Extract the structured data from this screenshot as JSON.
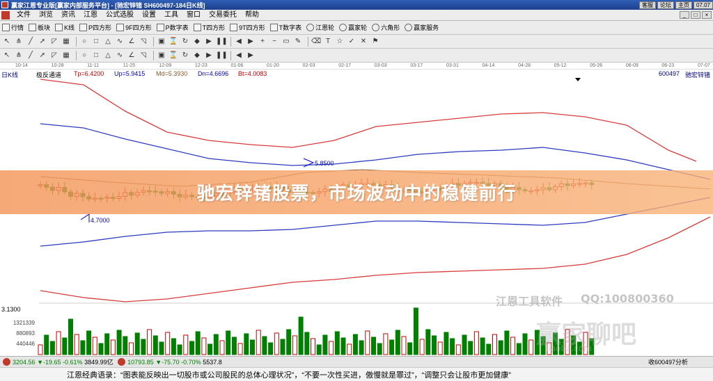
{
  "titlebar": {
    "title": "赢家江恩专业版[赢家内部服务平台] - [驰宏锌锗  SH600497-184日K线]",
    "buttons": [
      "客服",
      "论坛",
      "主页",
      "07.07"
    ]
  },
  "menubar": {
    "items": [
      "文件",
      "浏览",
      "资讯",
      "江恩",
      "公式选股",
      "设置",
      "工具",
      "窗口",
      "交易委托",
      "帮助"
    ],
    "controls": [
      "_",
      "□",
      "×"
    ]
  },
  "toolbar1": {
    "items": [
      {
        "icon": "list-icon",
        "label": "行情"
      },
      {
        "icon": "grid-icon",
        "label": "板块"
      },
      {
        "icon": "candle-icon",
        "label": "K线"
      },
      {
        "icon": "p-box-icon",
        "label": "P四方形"
      },
      {
        "icon": "9f-box-icon",
        "label": "9F四方形"
      },
      {
        "icon": "p-char-icon",
        "label": "P数字表"
      },
      {
        "icon": "t-box-icon",
        "label": "T四方形"
      },
      {
        "icon": "9t-box-icon",
        "label": "9T四方形"
      },
      {
        "icon": "t-char-icon",
        "label": "T数字表"
      },
      {
        "icon": "wheel-icon",
        "label": "江恩轮"
      },
      {
        "icon": "wheel2-icon",
        "label": "赢家轮"
      },
      {
        "icon": "hexagon-icon",
        "label": "六角形"
      },
      {
        "icon": "service-icon",
        "label": "赢家服务"
      }
    ]
  },
  "toolbar2": {
    "icons": [
      "cursor-icon",
      "fork-icon",
      "line-icon",
      "arrow-icon",
      "fan-icon",
      "grid-icon",
      "circle-icon",
      "square-icon",
      "triangle-icon",
      "wave-icon",
      "gann-angle-icon",
      "gann-fan-icon",
      "box-icon",
      "time-icon",
      "cycle-icon",
      "diamond-icon",
      "play-icon",
      "pause-icon",
      "left-arrow-icon",
      "right-arrow-icon",
      "zoom-in-icon",
      "zoom-out-icon",
      "ruler-icon",
      "pencil-icon",
      "eraser-icon",
      "text-icon",
      "star-icon",
      "check-icon",
      "cross-icon",
      "flag-icon"
    ]
  },
  "toolbar3": {
    "icons": [
      "arrow-up-icon",
      "fork-icon",
      "spiral-icon",
      "angle-icon",
      "wave-icon",
      "bar-icon",
      "pivot-icon",
      "square-icon",
      "lines-icon",
      "channel-icon",
      "cross-icon",
      "fan-icon",
      "grid-icon",
      "cycle-icon",
      "arc-icon",
      "box-icon",
      "time-icon",
      "star-icon",
      "pie-icon",
      "circle-icon"
    ]
  },
  "date_axis": {
    "labels": [
      "10-14",
      "10-28",
      "11-11",
      "11-25",
      "12-09",
      "12-23",
      "01-06",
      "01-20",
      "02-03",
      "02-17",
      "03-03",
      "03-17",
      "03-31",
      "04-14",
      "04-28",
      "05-12",
      "05-26",
      "06-09",
      "06-23",
      "07-07"
    ]
  },
  "indicator_header": {
    "chart_type": "日K线",
    "name": "极反通道",
    "tp": "Tp=6.4200",
    "up": "Up=5.9415",
    "md": "Md=5.3930",
    "dn": "Dn=4.6696",
    "bt": "Bt=4.0083",
    "code": "600497",
    "stock": "驰宏锌锗"
  },
  "chart_data": {
    "type": "candlestick",
    "annotations": {
      "high": "5.8500",
      "low": "4.7000"
    },
    "y_low_label": "3.1300",
    "volume_ticks": [
      "1321339",
      "880893",
      "440446"
    ]
  },
  "banner": {
    "title": "驰宏锌锗股票，市场波动中的稳健前行"
  },
  "watermarks": {
    "tools": "江恩工具软件",
    "qq": "QQ:100800360",
    "brand": "赢家聊吧",
    "site": "liaoba.com"
  },
  "statusbar": {
    "sh_index": "3204.56",
    "sh_change": "▼-19.65",
    "sh_pct": "-0.61%",
    "sh_amount": "3849.99亿",
    "sz_index": "10793.85",
    "sz_change": "▼-75.70",
    "sz_pct": "-0.70%",
    "sz_amount": "5537.8",
    "right_label": "收600497分析"
  },
  "quotebar": {
    "quote": "江恩经典语录：“图表能反映出一切股市或公司股民的总体心理状况”，“不要一次性买进，傲慢就是罪过”，“调整只会让股市更加健康”"
  },
  "colors": {
    "up_candle": "#c00000",
    "down_candle": "#008000",
    "outer_band": "#d93a3a",
    "inner_band": "#2b3bbf",
    "mid_band": "#8a5a2a",
    "banner": "#f4965a"
  }
}
